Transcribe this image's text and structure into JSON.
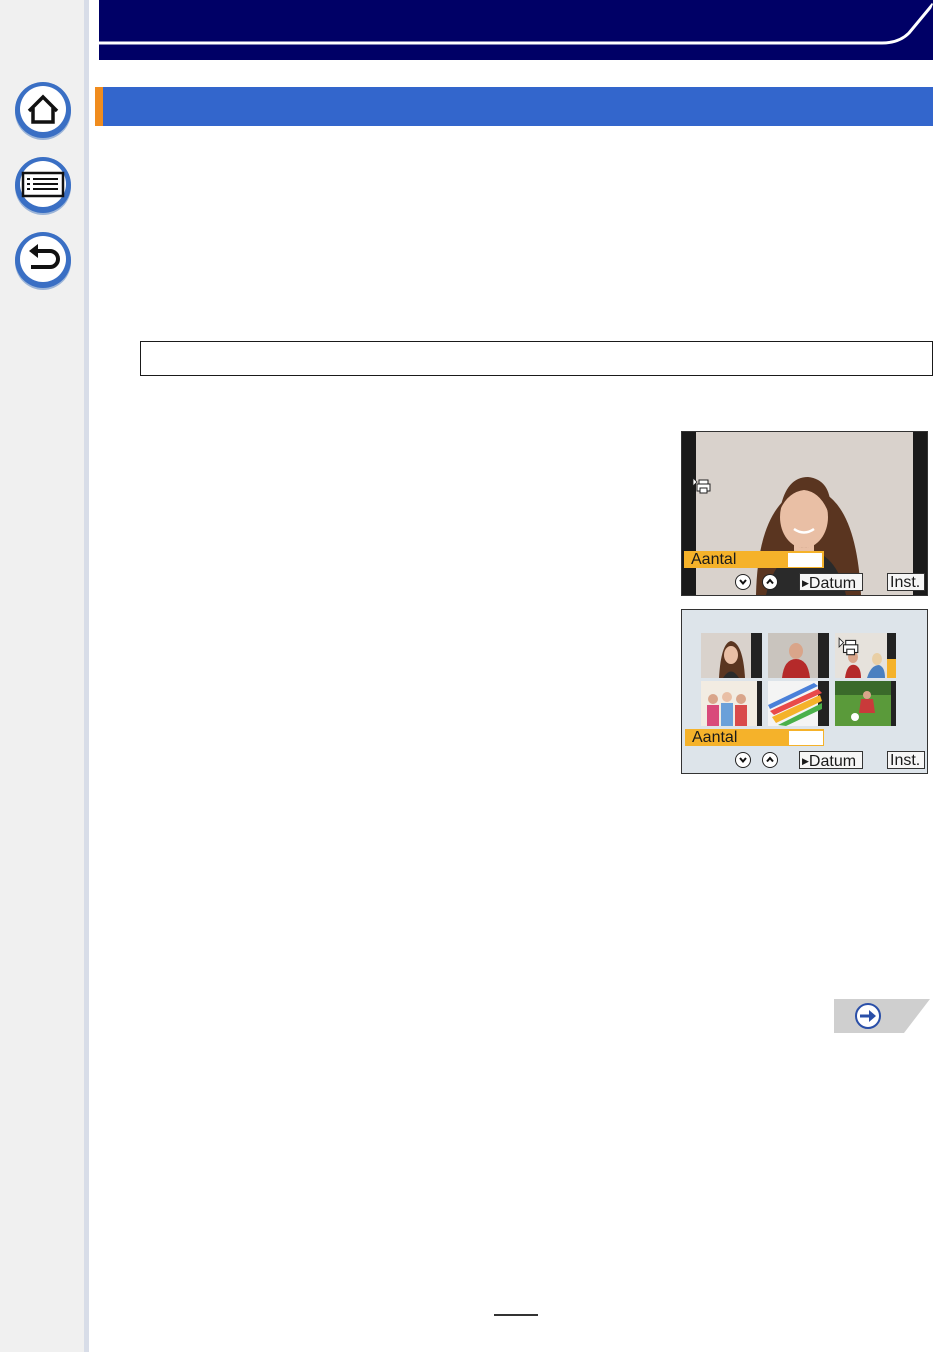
{
  "nav": {
    "home_icon": "home-icon",
    "menu_icon": "list-menu-icon",
    "back_icon": "back-arrow-icon"
  },
  "colors": {
    "header_navy": "#000066",
    "section_blue": "#3366cc",
    "section_accent": "#f08c1e",
    "aantal_bar": "#f5b22a"
  },
  "screen_single": {
    "aantal_label": "Aantal",
    "datum_button": "Datum",
    "inst_button": "Inst.",
    "print_icon": "print-set-icon",
    "down_icon": "chevron-down-icon",
    "up_icon": "chevron-up-icon"
  },
  "screen_multi": {
    "aantal_label": "Aantal",
    "datum_button": "Datum",
    "inst_button": "Inst.",
    "print_icon": "print-set-icon",
    "down_icon": "chevron-down-icon",
    "up_icon": "chevron-up-icon"
  },
  "next_page_icon": "next-page-arrow-icon",
  "page_number": ""
}
